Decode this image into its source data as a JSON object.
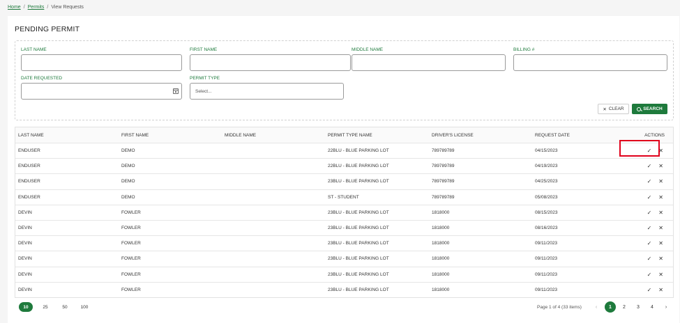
{
  "breadcrumb": {
    "home": "Home",
    "permits": "Permits",
    "current": "View Requests",
    "sep": "/"
  },
  "page": {
    "title": "PENDING PERMIT"
  },
  "filters": {
    "last_name_label": "LAST NAME",
    "first_name_label": "FIRST NAME",
    "middle_name_label": "MIDDLE NAME",
    "billing_label": "BILLING #",
    "date_label": "DATE REQUESTED",
    "permit_type_label": "PERMIT TYPE",
    "permit_type_placeholder": "Select...",
    "clear_label": "CLEAR",
    "search_label": "SEARCH"
  },
  "table": {
    "headers": [
      "LAST NAME",
      "FIRST NAME",
      "MIDDLE NAME",
      "PERMIT TYPE NAME",
      "DRIVER'S LICENSE",
      "REQUEST DATE",
      "ACTIONS"
    ],
    "rows": [
      [
        "ENDUSER",
        "DEMO",
        "",
        "22BLU - BLUE PARKING LOT",
        "789789789",
        "04/15/2023"
      ],
      [
        "ENDUSER",
        "DEMO",
        "",
        "22BLU - BLUE PARKING LOT",
        "789789789",
        "04/19/2023"
      ],
      [
        "ENDUSER",
        "DEMO",
        "",
        "23BLU - BLUE PARKING LOT",
        "789789789",
        "04/25/2023"
      ],
      [
        "ENDUSER",
        "DEMO",
        "",
        "ST - STUDENT",
        "789789789",
        "05/08/2023"
      ],
      [
        "DEVIN",
        "FOWLER",
        "",
        "23BLU - BLUE PARKING LOT",
        "1818000",
        "08/15/2023"
      ],
      [
        "DEVIN",
        "FOWLER",
        "",
        "23BLU - BLUE PARKING LOT",
        "1818000",
        "08/16/2023"
      ],
      [
        "DEVIN",
        "FOWLER",
        "",
        "23BLU - BLUE PARKING LOT",
        "1818000",
        "09/11/2023"
      ],
      [
        "DEVIN",
        "FOWLER",
        "",
        "23BLU - BLUE PARKING LOT",
        "1818000",
        "09/11/2023"
      ],
      [
        "DEVIN",
        "FOWLER",
        "",
        "23BLU - BLUE PARKING LOT",
        "1818000",
        "09/11/2023"
      ],
      [
        "DEVIN",
        "FOWLER",
        "",
        "23BLU - BLUE PARKING LOT",
        "1818000",
        "09/11/2023"
      ]
    ],
    "approve_icon": "✓",
    "reject_icon": "✕"
  },
  "pagination": {
    "sizes": [
      "10",
      "25",
      "50",
      "100"
    ],
    "active_size": "10",
    "info": "Page 1 of 4 (33 items)",
    "pages": [
      "1",
      "2",
      "3",
      "4"
    ],
    "active_page": "1",
    "prev": "‹",
    "next": "›"
  },
  "colors": {
    "accent": "#1e7a3c",
    "highlight": "#e0001b"
  }
}
